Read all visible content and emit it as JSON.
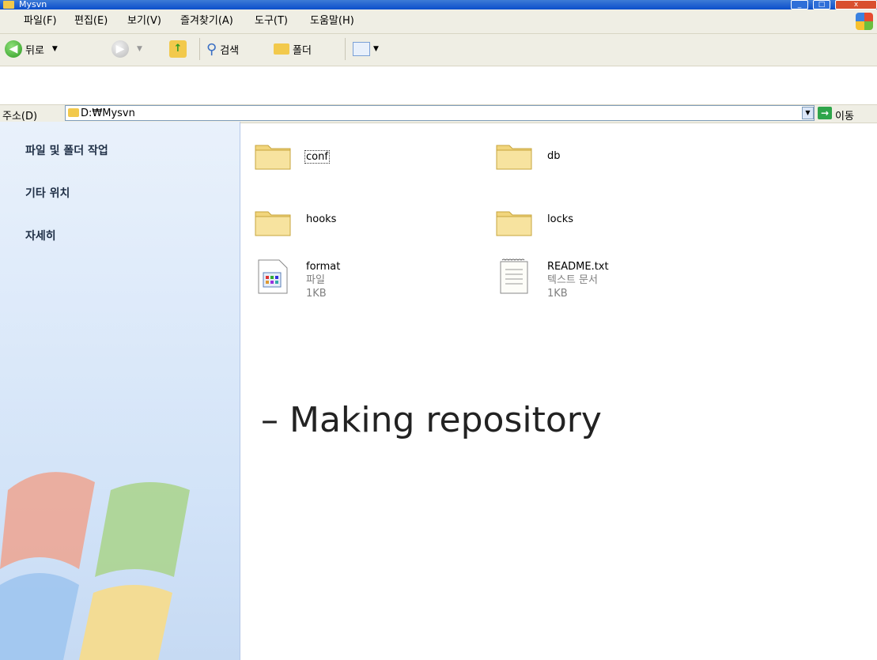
{
  "window": {
    "title": "Mysvn",
    "minimize_label": "_",
    "maximize_label": "□",
    "close_label": "x"
  },
  "menu": [
    "파일(F)",
    "편집(E)",
    "보기(V)",
    "즐겨찾기(A)",
    "도구(T)",
    "도움말(H)"
  ],
  "toolbar": {
    "back_label": "뒤로",
    "search_label": "검색",
    "folders_label": "폴더"
  },
  "address": {
    "label": "주소(D)",
    "value": "D:₩Mysvn",
    "go_label": "이동"
  },
  "left_pane": {
    "sections": [
      "파일 및 폴더 작업",
      "기타 위치",
      "자세히"
    ]
  },
  "files": [
    {
      "name": "conf",
      "type": "folder"
    },
    {
      "name": "db",
      "type": "folder"
    },
    {
      "name": "hooks",
      "type": "folder"
    },
    {
      "name": "locks",
      "type": "folder"
    },
    {
      "name": "format",
      "type": "file",
      "kind": "파일",
      "size": "1KB"
    },
    {
      "name": "README.txt",
      "type": "file",
      "kind": "텍스트 문서",
      "size": "1KB"
    }
  ],
  "overlay_text": "–  Making repository"
}
